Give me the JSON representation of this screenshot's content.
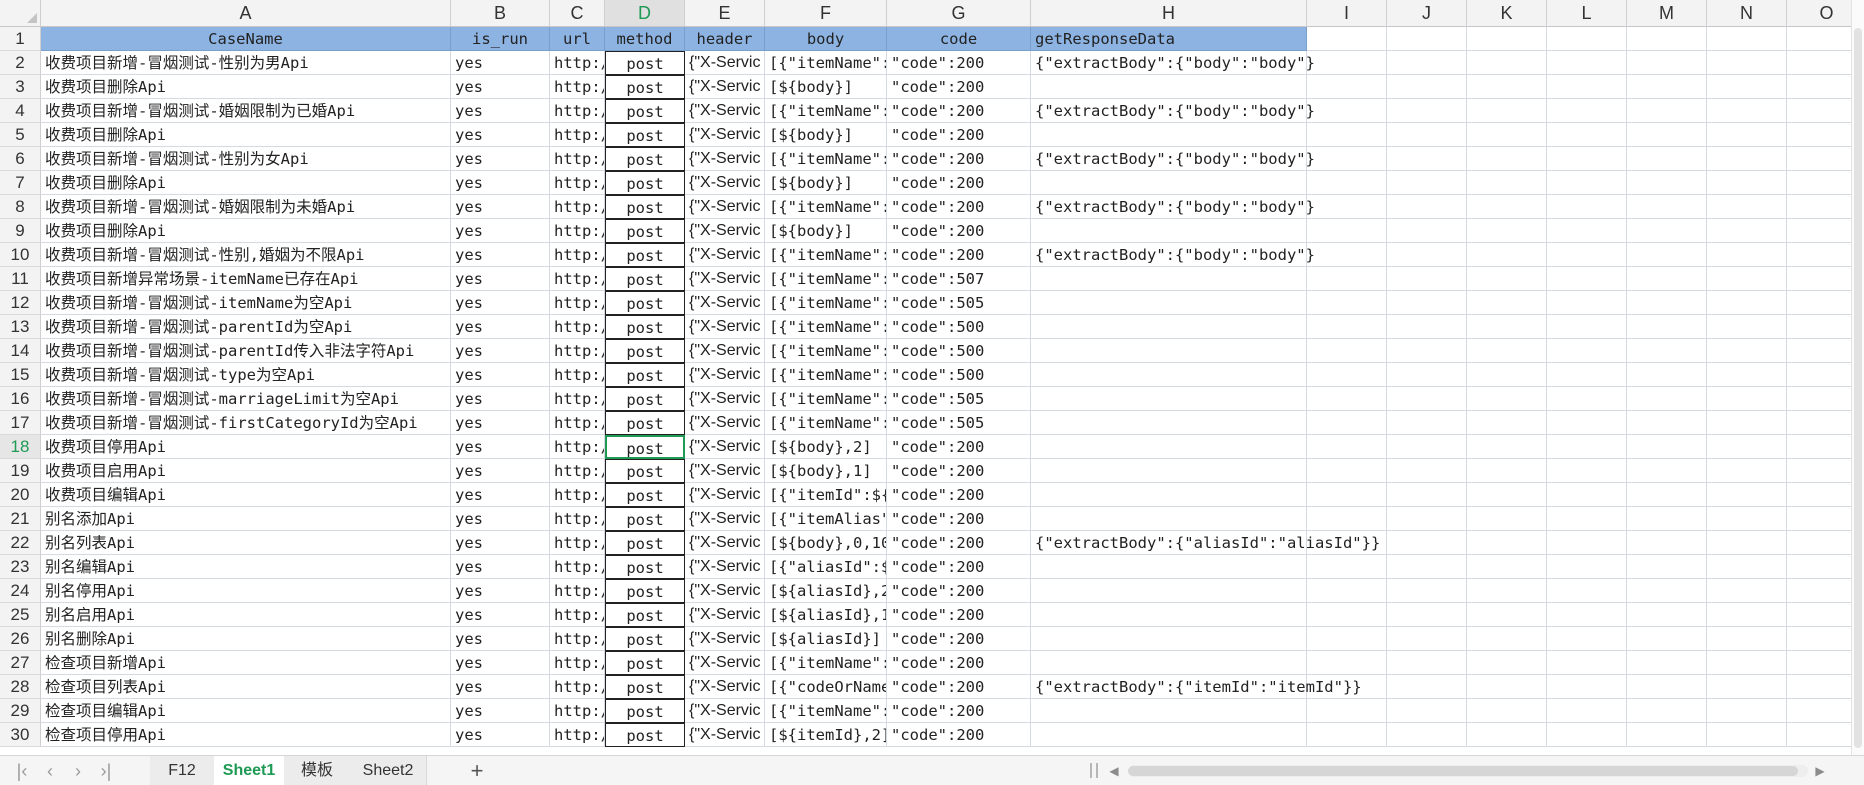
{
  "columns": [
    "A",
    "B",
    "C",
    "D",
    "E",
    "F",
    "G",
    "H",
    "I",
    "J",
    "K",
    "L",
    "M",
    "N",
    "O"
  ],
  "selected_column": "D",
  "header_row": [
    "CaseName",
    "is_run",
    "url",
    "method",
    "header",
    "body",
    "code",
    "getResponseData"
  ],
  "selected_row": 18,
  "rows": [
    {
      "n": 2,
      "case": "收费项目新增-冒烟测试-性别为男Api",
      "run": "yes",
      "url": "http:/",
      "method": "post",
      "header": "{\"X-Servic",
      "body": "[{\"itemName\":",
      "code": "\"code\":200",
      "resp": "{\"extractBody\":{\"body\":\"body\"}"
    },
    {
      "n": 3,
      "case": "收费项目删除Api",
      "run": "yes",
      "url": "http:/",
      "method": "post",
      "header": "{\"X-Servic",
      "body": "[${body}]",
      "code": "\"code\":200",
      "resp": ""
    },
    {
      "n": 4,
      "case": "收费项目新增-冒烟测试-婚姻限制为已婚Api",
      "run": "yes",
      "url": "http:/",
      "method": "post",
      "header": "{\"X-Servic",
      "body": "[{\"itemName\":",
      "code": "\"code\":200",
      "resp": "{\"extractBody\":{\"body\":\"body\"}"
    },
    {
      "n": 5,
      "case": "收费项目删除Api",
      "run": "yes",
      "url": "http:/",
      "method": "post",
      "header": "{\"X-Servic",
      "body": "[${body}]",
      "code": "\"code\":200",
      "resp": ""
    },
    {
      "n": 6,
      "case": "收费项目新增-冒烟测试-性别为女Api",
      "run": "yes",
      "url": "http:/",
      "method": "post",
      "header": "{\"X-Servic",
      "body": "[{\"itemName\":",
      "code": "\"code\":200",
      "resp": "{\"extractBody\":{\"body\":\"body\"}"
    },
    {
      "n": 7,
      "case": "收费项目删除Api",
      "run": "yes",
      "url": "http:/",
      "method": "post",
      "header": "{\"X-Servic",
      "body": "[${body}]",
      "code": "\"code\":200",
      "resp": ""
    },
    {
      "n": 8,
      "case": "收费项目新增-冒烟测试-婚姻限制为未婚Api",
      "run": "yes",
      "url": "http:/",
      "method": "post",
      "header": "{\"X-Servic",
      "body": "[{\"itemName\":",
      "code": "\"code\":200",
      "resp": "{\"extractBody\":{\"body\":\"body\"}"
    },
    {
      "n": 9,
      "case": "收费项目删除Api",
      "run": "yes",
      "url": "http:/",
      "method": "post",
      "header": "{\"X-Servic",
      "body": "[${body}]",
      "code": "\"code\":200",
      "resp": ""
    },
    {
      "n": 10,
      "case": "收费项目新增-冒烟测试-性别,婚姻为不限Api",
      "run": "yes",
      "url": "http:/",
      "method": "post",
      "header": "{\"X-Servic",
      "body": "[{\"itemName\":",
      "code": "\"code\":200",
      "resp": "{\"extractBody\":{\"body\":\"body\"}"
    },
    {
      "n": 11,
      "case": "收费项目新增异常场景-itemName已存在Api",
      "run": "yes",
      "url": "http:/",
      "method": "post",
      "header": "{\"X-Servic",
      "body": "[{\"itemName\":",
      "code": "\"code\":507",
      "resp": ""
    },
    {
      "n": 12,
      "case": "收费项目新增-冒烟测试-itemName为空Api",
      "run": "yes",
      "url": "http:/",
      "method": "post",
      "header": "{\"X-Servic",
      "body": "[{\"itemName\":",
      "code": "\"code\":505",
      "resp": ""
    },
    {
      "n": 13,
      "case": "收费项目新增-冒烟测试-parentId为空Api",
      "run": "yes",
      "url": "http:/",
      "method": "post",
      "header": "{\"X-Servic",
      "body": "[{\"itemName\":",
      "code": "\"code\":500",
      "resp": ""
    },
    {
      "n": 14,
      "case": "收费项目新增-冒烟测试-parentId传入非法字符Api",
      "run": "yes",
      "url": "http:/",
      "method": "post",
      "header": "{\"X-Servic",
      "body": "[{\"itemName\":",
      "code": "\"code\":500",
      "resp": ""
    },
    {
      "n": 15,
      "case": "收费项目新增-冒烟测试-type为空Api",
      "run": "yes",
      "url": "http:/",
      "method": "post",
      "header": "{\"X-Servic",
      "body": "[{\"itemName\":",
      "code": "\"code\":500",
      "resp": ""
    },
    {
      "n": 16,
      "case": "收费项目新增-冒烟测试-marriageLimit为空Api",
      "run": "yes",
      "url": "http:/",
      "method": "post",
      "header": "{\"X-Servic",
      "body": "[{\"itemName\":",
      "code": "\"code\":505",
      "resp": ""
    },
    {
      "n": 17,
      "case": "收费项目新增-冒烟测试-firstCategoryId为空Api",
      "run": "yes",
      "url": "http:/",
      "method": "post",
      "header": "{\"X-Servic",
      "body": "[{\"itemName\":",
      "code": "\"code\":505",
      "resp": ""
    },
    {
      "n": 18,
      "case": "收费项目停用Api",
      "run": "yes",
      "url": "http:/",
      "method": "post",
      "header": "{\"X-Servic",
      "body": "[${body},2]",
      "code": "\"code\":200",
      "resp": ""
    },
    {
      "n": 19,
      "case": "收费项目启用Api",
      "run": "yes",
      "url": "http:/",
      "method": "post",
      "header": "{\"X-Servic",
      "body": "[${body},1]",
      "code": "\"code\":200",
      "resp": ""
    },
    {
      "n": 20,
      "case": "收费项目编辑Api",
      "run": "yes",
      "url": "http:/",
      "method": "post",
      "header": "{\"X-Servic",
      "body": "[{\"itemId\":${",
      "code": "\"code\":200",
      "resp": ""
    },
    {
      "n": 21,
      "case": "别名添加Api",
      "run": "yes",
      "url": "http:/",
      "method": "post",
      "header": "{\"X-Servic",
      "body": "[{\"itemAlias\"",
      "code": "\"code\":200",
      "resp": ""
    },
    {
      "n": 22,
      "case": "别名列表Api",
      "run": "yes",
      "url": "http:/",
      "method": "post",
      "header": "{\"X-Servic",
      "body": "[${body},0,10",
      "code": "\"code\":200",
      "resp": "{\"extractBody\":{\"aliasId\":\"aliasId\"}}"
    },
    {
      "n": 23,
      "case": "别名编辑Api",
      "run": "yes",
      "url": "http:/",
      "method": "post",
      "header": "{\"X-Servic",
      "body": "[{\"aliasId\":$",
      "code": "\"code\":200",
      "resp": ""
    },
    {
      "n": 24,
      "case": "别名停用Api",
      "run": "yes",
      "url": "http:/",
      "method": "post",
      "header": "{\"X-Servic",
      "body": "[${aliasId},2",
      "code": "\"code\":200",
      "resp": ""
    },
    {
      "n": 25,
      "case": "别名启用Api",
      "run": "yes",
      "url": "http:/",
      "method": "post",
      "header": "{\"X-Servic",
      "body": "[${aliasId},1",
      "code": "\"code\":200",
      "resp": ""
    },
    {
      "n": 26,
      "case": "别名删除Api",
      "run": "yes",
      "url": "http:/",
      "method": "post",
      "header": "{\"X-Servic",
      "body": "[${aliasId}]",
      "code": "\"code\":200",
      "resp": ""
    },
    {
      "n": 27,
      "case": "检查项目新增Api",
      "run": "yes",
      "url": "http:/",
      "method": "post",
      "header": "{\"X-Servic",
      "body": "[{\"itemName\":",
      "code": "\"code\":200",
      "resp": ""
    },
    {
      "n": 28,
      "case": "检查项目列表Api",
      "run": "yes",
      "url": "http:/",
      "method": "post",
      "header": "{\"X-Servic",
      "body": "[{\"codeOrName",
      "code": "\"code\":200",
      "resp": "{\"extractBody\":{\"itemId\":\"itemId\"}}"
    },
    {
      "n": 29,
      "case": "检查项目编辑Api",
      "run": "yes",
      "url": "http:/",
      "method": "post",
      "header": "{\"X-Servic",
      "body": "[{\"itemName\":",
      "code": "\"code\":200",
      "resp": ""
    },
    {
      "n": 30,
      "case": "检查项目停用Api",
      "run": "yes",
      "url": "http:/",
      "method": "post",
      "header": "{\"X-Servic",
      "body": "[${itemId},2]",
      "code": "\"code\":200",
      "resp": ""
    }
  ],
  "tabs": [
    {
      "label": "F12",
      "active": false
    },
    {
      "label": "Sheet1",
      "active": true
    },
    {
      "label": "模板",
      "active": false
    },
    {
      "label": "Sheet2",
      "active": false
    }
  ],
  "add_sheet_symbol": "+",
  "icons": {
    "first": "first-sheet-icon",
    "prev": "prev-sheet-icon",
    "next": "next-sheet-icon",
    "last": "last-sheet-icon",
    "add": "add-sheet-icon",
    "scroll_left": "scroll-left-icon",
    "scroll_right": "scroll-right-icon"
  },
  "colors": {
    "header_fill": "#8db3e2",
    "accent": "#1e9a54"
  }
}
